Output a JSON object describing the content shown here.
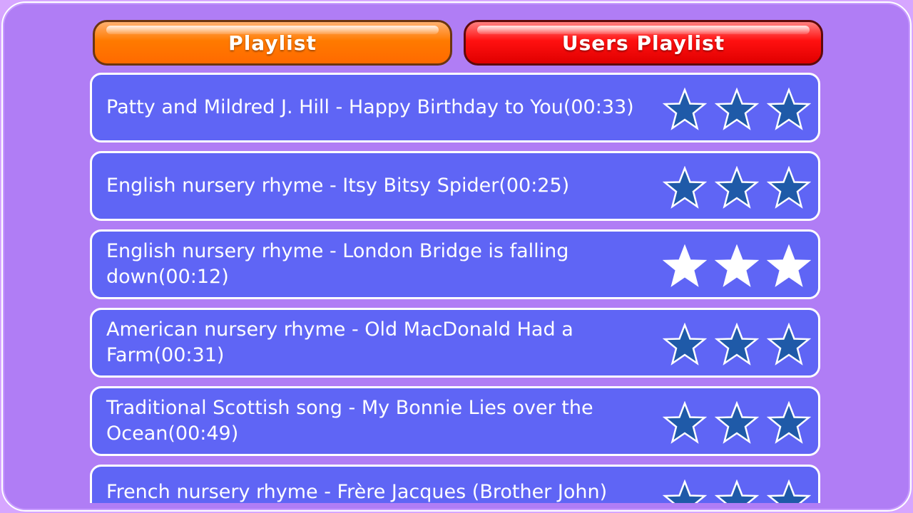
{
  "tabs": {
    "playlist": "Playlist",
    "users_playlist": "Users Playlist"
  },
  "colors": {
    "star_empty_fill": "#1f5aa8",
    "star_filled_fill": "#ffffff",
    "star_stroke": "#ffffff"
  },
  "songs": [
    {
      "title": "Patty and Mildred J. Hill - Happy Birthday to You(00:33)",
      "rating_filled": 0
    },
    {
      "title": "English nursery rhyme - Itsy Bitsy Spider(00:25)",
      "rating_filled": 0
    },
    {
      "title": "English nursery rhyme - London Bridge is falling down(00:12)",
      "rating_filled": 3
    },
    {
      "title": "American nursery rhyme - Old MacDonald Had a Farm(00:31)",
      "rating_filled": 0
    },
    {
      "title": "Traditional Scottish song - My Bonnie Lies over the Ocean(00:49)",
      "rating_filled": 0
    },
    {
      "title": "French nursery rhyme - Frère Jacques (Brother John)",
      "rating_filled": 0
    }
  ]
}
